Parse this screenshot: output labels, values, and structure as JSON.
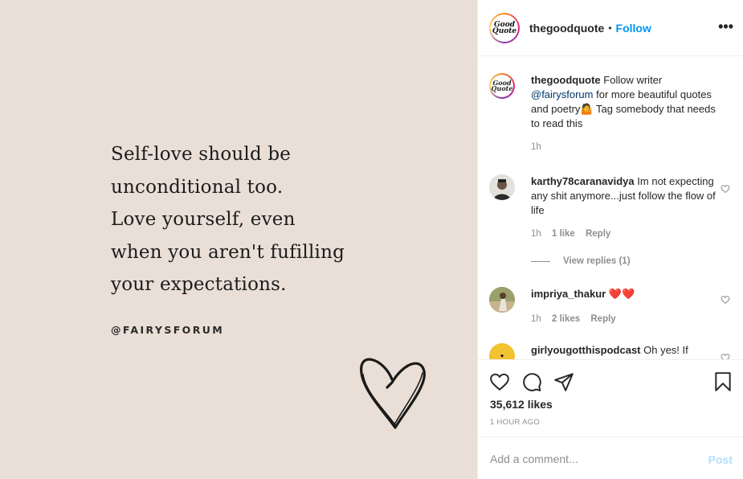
{
  "post_image": {
    "quote_lines": [
      "Self-love should be",
      "unconditional too.",
      "Love yourself, even",
      "when you aren't fufilling",
      "your expectations."
    ],
    "handle": "@FAIRYSFORUM",
    "background": "#e9dfd6"
  },
  "header": {
    "username": "thegoodquote",
    "separator": "•",
    "follow_label": "Follow",
    "more_label": "•••",
    "avatar_text": "Good Quote"
  },
  "caption": {
    "username": "thegoodquote",
    "text_before_mention": "Follow writer",
    "mention": "@fairysforum",
    "text_after_mention": "for more beautiful quotes and poetry🤷 Tag somebody that needs to read this",
    "time": "1h"
  },
  "comments": [
    {
      "username": "karthy78caranavidya",
      "text": "Im not expecting any shit anymore...just follow the flow of life",
      "time": "1h",
      "likes": "1 like",
      "reply_label": "Reply",
      "view_replies": "View replies (1)"
    },
    {
      "username": "impriya_thakur",
      "text": "❤️❤️",
      "time": "1h",
      "likes": "2 likes",
      "reply_label": "Reply"
    },
    {
      "username": "girlyougotthispodcast",
      "text": "Oh yes! If"
    }
  ],
  "actions": {
    "likes_count": "35,612 likes",
    "timestamp": "1 HOUR AGO",
    "icons": [
      "heart-icon",
      "comment-icon",
      "share-icon",
      "bookmark-icon"
    ]
  },
  "add_comment": {
    "placeholder": "Add a comment...",
    "post_label": "Post"
  },
  "colors": {
    "accent": "#0095f6",
    "link": "#00376b",
    "muted": "#8e8e8e",
    "post_disabled": "#b2dffc"
  }
}
